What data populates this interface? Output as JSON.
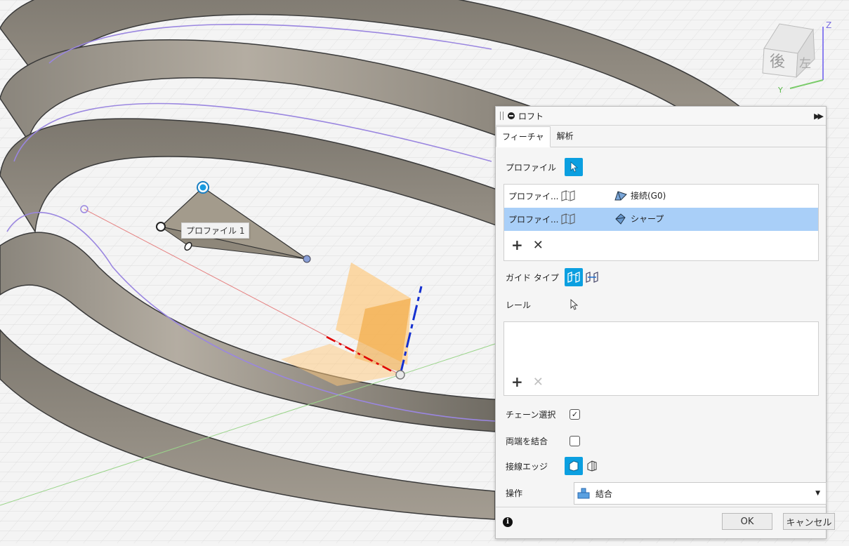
{
  "viewport": {
    "tooltip": "プロファイル 1",
    "viewcube": {
      "face_back": "後",
      "face_left": "左",
      "axis_z": "Z",
      "axis_y": "Y"
    }
  },
  "dialog": {
    "title": "ロフト",
    "tabs": [
      {
        "label": "フィーチャ",
        "active": true
      },
      {
        "label": "解析",
        "active": false
      }
    ],
    "profile_label": "プロファイル",
    "profiles": [
      {
        "name": "プロファイ...",
        "condition": "接続(G0)",
        "selected": false
      },
      {
        "name": "プロファイ...",
        "condition": "シャープ",
        "selected": true
      }
    ],
    "guide_type_label": "ガイド タイプ",
    "rail_label": "レール",
    "chain_select_label": "チェーン選択",
    "chain_select_checked": true,
    "closed_label": "両端を結合",
    "closed_checked": false,
    "tangent_edges_label": "接線エッジ",
    "operation_label": "操作",
    "operation_value": "結合",
    "ok_label": "OK",
    "cancel_label": "キャンセル"
  },
  "colors": {
    "accent": "#0b9fe0",
    "selected_row": "#a9cff8"
  }
}
